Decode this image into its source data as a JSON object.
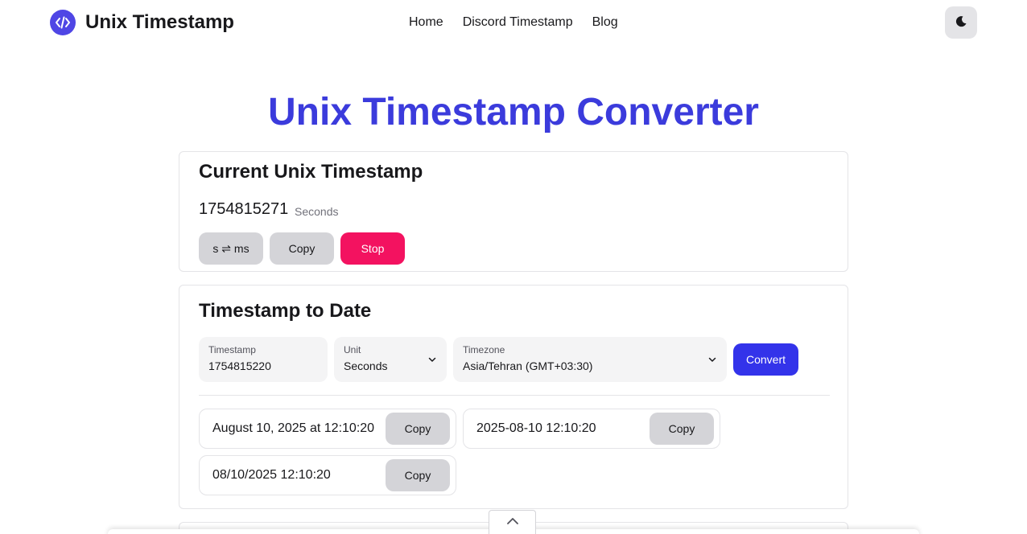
{
  "header": {
    "logo_text": "Unix Timestamp",
    "nav": [
      "Home",
      "Discord Timestamp",
      "Blog"
    ],
    "theme_icon": "moon-icon"
  },
  "title": "Unix Timestamp Converter",
  "current": {
    "heading": "Current Unix Timestamp",
    "value": "1754815271",
    "unit": "Seconds",
    "swap_label": "s ⇌ ms",
    "copy_label": "Copy",
    "stop_label": "Stop"
  },
  "ts_to_date": {
    "heading": "Timestamp to Date",
    "timestamp_label": "Timestamp",
    "timestamp_value": "1754815220",
    "unit_label": "Unit",
    "unit_value": "Seconds",
    "timezone_label": "Timezone",
    "timezone_value": "Asia/Tehran (GMT+03:30)",
    "convert_label": "Convert",
    "results": [
      {
        "text": "August 10, 2025 at 12:10:20",
        "copy": "Copy"
      },
      {
        "text": "2025-08-10 12:10:20",
        "copy": "Copy"
      },
      {
        "text": "08/10/2025 12:10:20",
        "copy": "Copy"
      }
    ]
  },
  "colors": {
    "accent": "#3b3bdc",
    "logo": "#4f46e5",
    "convert": "#3333ea",
    "stop": "#f31260",
    "button_gray": "#d4d4d8"
  }
}
